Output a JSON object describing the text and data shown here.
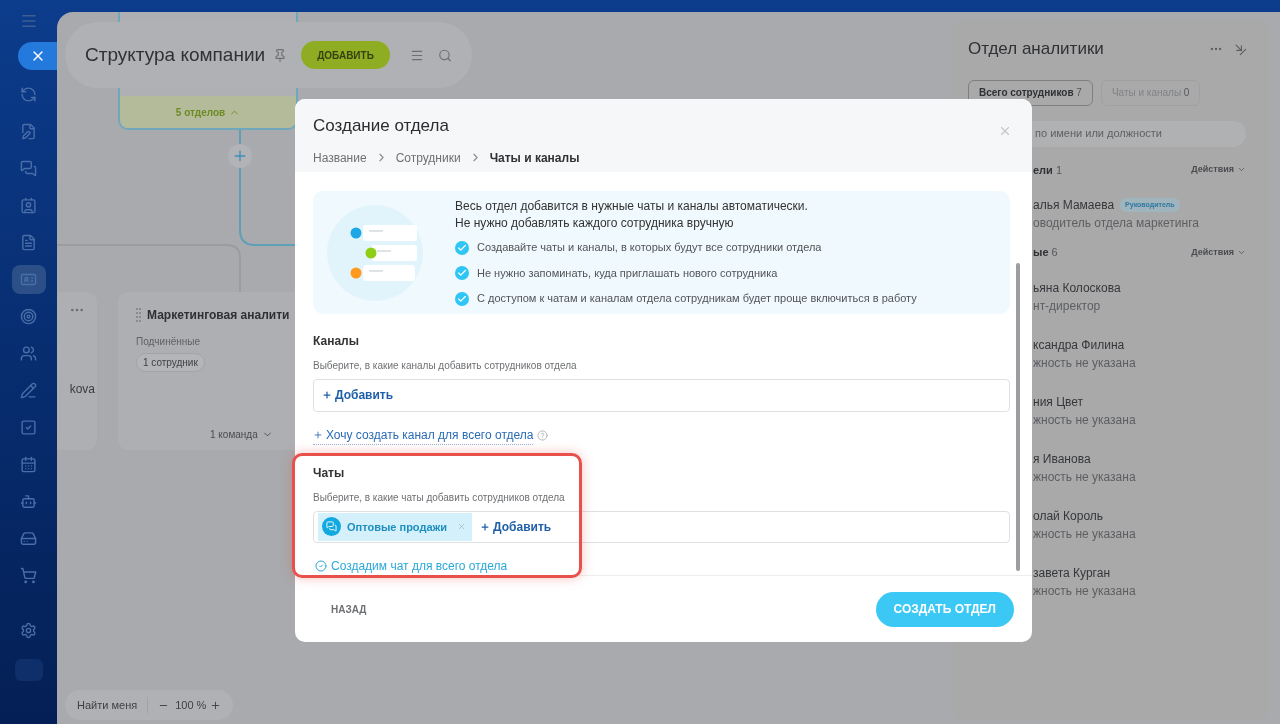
{
  "sidebar": {
    "items": [
      {
        "selected": false
      },
      {
        "selected": false
      },
      {
        "selected": false
      },
      {
        "selected": false
      },
      {
        "selected": false
      },
      {
        "selected": true
      },
      {
        "selected": false
      },
      {
        "selected": false
      },
      {
        "selected": false
      },
      {
        "selected": false
      },
      {
        "selected": false
      },
      {
        "selected": false
      },
      {
        "selected": false
      },
      {
        "selected": false
      },
      {
        "selected": false
      }
    ]
  },
  "header": {
    "title": "Структура компании",
    "add_button": "ДОБАВИТЬ"
  },
  "canvas": {
    "top_node": {
      "toggle": "5 отделов"
    },
    "left_node": {
      "text": "kova"
    },
    "marketing_node": {
      "title": "Маркетинговая аналити",
      "label": "Подчинённые",
      "badge": "1 сотрудник",
      "footer": "1 команда"
    }
  },
  "zoom_bar": {
    "find_me": "Найти меня",
    "zoom": "100 %"
  },
  "modal": {
    "title": "Создание отдела",
    "steps": [
      {
        "label": "Название",
        "selected": false
      },
      {
        "label": "Сотрудники",
        "selected": false
      },
      {
        "label": "Чаты и каналы",
        "selected": true
      }
    ],
    "info": {
      "lines": [
        "Весь отдел добавится в нужные чаты и каналы автоматически.",
        "Не нужно добавлять каждого сотрудника вручную"
      ],
      "points": [
        "Создавайте чаты и каналы, в которых будут все сотрудники отдела",
        "Не нужно запоминать, куда приглашать нового сотрудника",
        "С доступом к чатам и каналам отдела сотрудникам будет проще включиться в работу"
      ]
    },
    "channels": {
      "title": "Каналы",
      "hint": "Выберите, в какие каналы добавить сотрудников отдела",
      "add": "Добавить",
      "create_link": "Хочу создать канал для всего отдела"
    },
    "chats": {
      "title": "Чаты",
      "hint": "Выберите, в какие чаты добавить сотрудников отдела",
      "tags": [
        {
          "label": "Оптовые продажи"
        }
      ],
      "add": "Добавить",
      "create_note": "Создадим чат для всего отдела",
      "highlighted": true
    },
    "back": "НАЗАД",
    "submit": "СОЗДАТЬ ОТДЕЛ"
  },
  "right_panel": {
    "title": "Отдел аналитики",
    "tabs": [
      {
        "label": "Всего сотрудников",
        "count": "7",
        "selected": true
      },
      {
        "label": "Чаты и каналы",
        "count": "0",
        "selected": false
      }
    ],
    "search": {
      "placeholder": "по имени или должности"
    },
    "groups": [
      {
        "title": "ели",
        "count": "1",
        "actions": "Действия",
        "members": [
          {
            "name": "алья Мамаева",
            "badge": "Руководитель",
            "position": "оводитель отдела маркетинга"
          }
        ]
      },
      {
        "title": "ые",
        "count": "6",
        "actions": "Действия",
        "members": [
          {
            "name": "ьяна Колоскова",
            "position": "нт-директор"
          },
          {
            "name": "ксандра Филина",
            "position": "жность не указана"
          },
          {
            "name": "ния Цвет",
            "position": "жность не указана"
          },
          {
            "name": "я Иванова",
            "position": "жность не указана"
          },
          {
            "name": "олай Король",
            "position": "жность не указана"
          },
          {
            "name": "завета Курган",
            "position": "жность не указана"
          }
        ]
      }
    ]
  }
}
